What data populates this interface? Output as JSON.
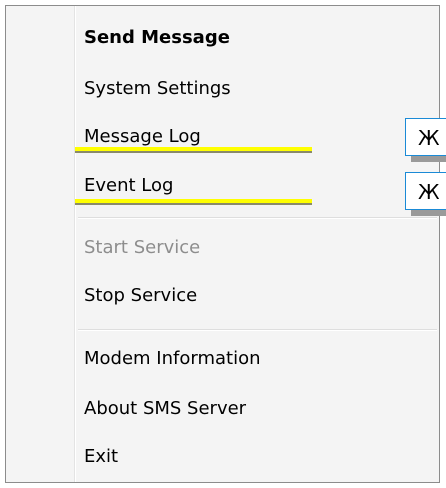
{
  "menu": {
    "items": [
      {
        "label": "Send Message",
        "bold": true,
        "disabled": false
      },
      {
        "label": "System Settings",
        "bold": false,
        "disabled": false
      },
      {
        "label": "Message Log",
        "bold": false,
        "disabled": false
      },
      {
        "label": "Event Log",
        "bold": false,
        "disabled": false
      },
      {
        "label": "Start Service",
        "bold": false,
        "disabled": true
      },
      {
        "label": "Stop Service",
        "bold": false,
        "disabled": false
      },
      {
        "label": "Modem Information",
        "bold": false,
        "disabled": false
      },
      {
        "label": "About SMS Server",
        "bold": false,
        "disabled": false
      },
      {
        "label": "Exit",
        "bold": false,
        "disabled": false
      }
    ]
  },
  "callouts": [
    {
      "text": "Ж"
    },
    {
      "text": "Ж"
    }
  ],
  "colors": {
    "highlight": "#ffff00",
    "disabled_text": "#8d8d8d",
    "callout_border": "#1a8ad6"
  }
}
